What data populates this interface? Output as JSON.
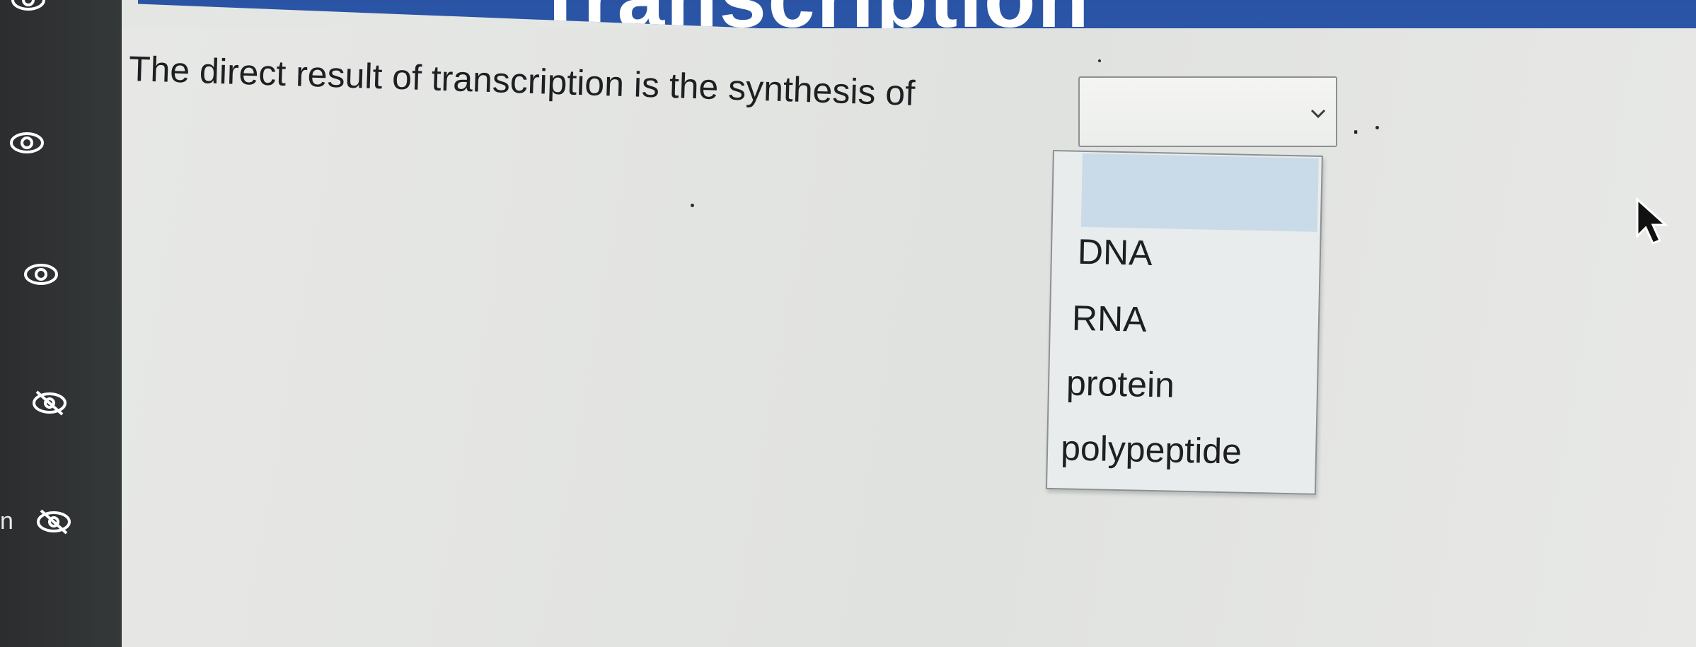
{
  "banner": {
    "title": "Transcription"
  },
  "sidebar": {
    "icons": [
      "eye-icon",
      "eye-icon",
      "eye-slash-icon",
      "eye-slash-icon"
    ],
    "partial_label": "n"
  },
  "question": {
    "text": "The direct result of transcription is the synthesis of",
    "trailing_punctuation": "."
  },
  "select": {
    "value": "",
    "options": [
      "",
      "DNA",
      "RNA",
      "protein",
      "polypeptide"
    ]
  },
  "colors": {
    "banner": "#2c58ab",
    "sidebar": "#2f3233",
    "highlight": "#c9dbe8",
    "background": "#e4e6e3"
  }
}
